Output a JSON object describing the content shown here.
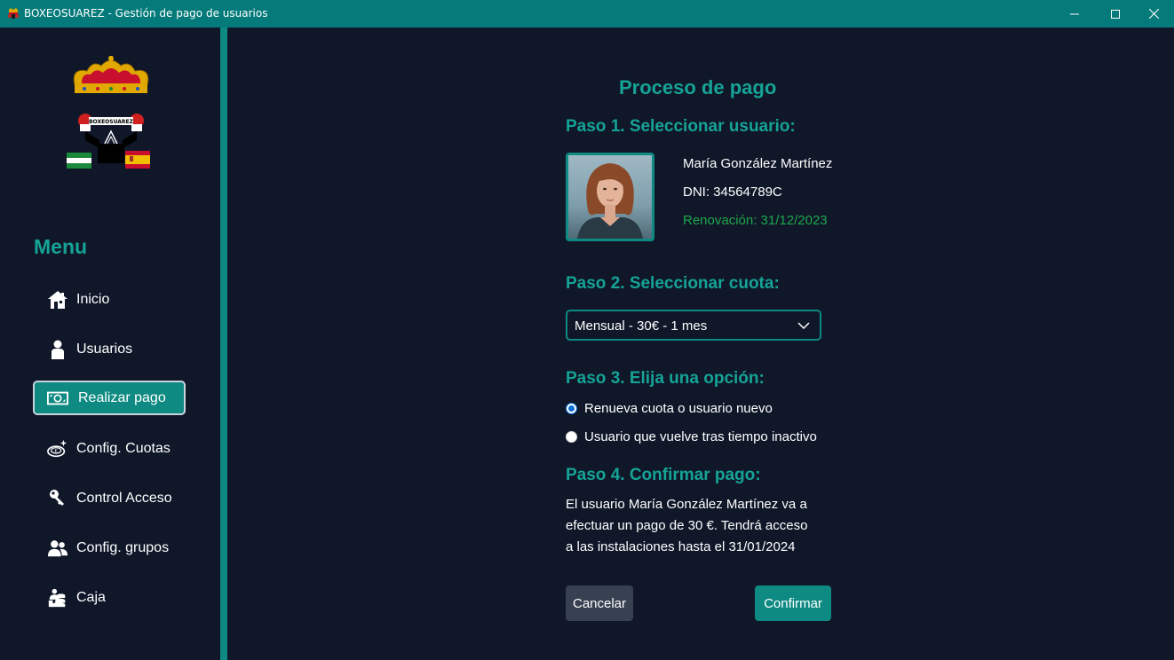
{
  "window": {
    "title": "BOXEOSUAREZ - Gestión de pago de usuarios",
    "controls": [
      "minimize",
      "maximize",
      "close"
    ]
  },
  "sidebar": {
    "logo_text": "BOXEOSUAREZ",
    "menu_title": "Menu",
    "items": [
      {
        "label": "Inicio",
        "icon": "home-icon",
        "active": false
      },
      {
        "label": "Usuarios",
        "icon": "user-icon",
        "active": false
      },
      {
        "label": "Realizar pago",
        "icon": "banknote-icon",
        "active": true
      },
      {
        "label": "Config. Cuotas",
        "icon": "coin-icon",
        "active": false
      },
      {
        "label": "Control Acceso",
        "icon": "key-icon",
        "active": false
      },
      {
        "label": "Config. grupos",
        "icon": "group-icon",
        "active": false
      },
      {
        "label": "Caja",
        "icon": "cash-register-icon",
        "active": false
      }
    ]
  },
  "main": {
    "title": "Proceso de pago",
    "step1": {
      "heading": "Paso 1. Seleccionar usuario:",
      "user": {
        "name": "María González Martínez",
        "dni": "DNI: 34564789C",
        "renewal": "Renovación: 31/12/2023"
      }
    },
    "step2": {
      "heading": "Paso 2. Seleccionar cuota:",
      "selected": "Mensual - 30€ - 1 mes"
    },
    "step3": {
      "heading": "Paso 3. Elija una opción:",
      "options": [
        {
          "label": "Renueva cuota o usuario nuevo",
          "checked": true
        },
        {
          "label": "Usuario que vuelve tras tiempo inactivo",
          "checked": false
        }
      ]
    },
    "step4": {
      "heading": "Paso 4. Confirmar pago:",
      "text_lines": [
        "El usuario María González Martínez va a",
        "efectuar un pago de 30 €. Tendrá acceso",
        "a las instalaciones hasta el 31/01/2024"
      ]
    },
    "buttons": {
      "cancel": "Cancelar",
      "confirm": "Confirmar"
    }
  },
  "colors": {
    "accent": "#0e8a82",
    "heading": "#16a396",
    "background": "#0f1729",
    "renewal": "#1fa84a",
    "titlebar": "#057a7a"
  }
}
